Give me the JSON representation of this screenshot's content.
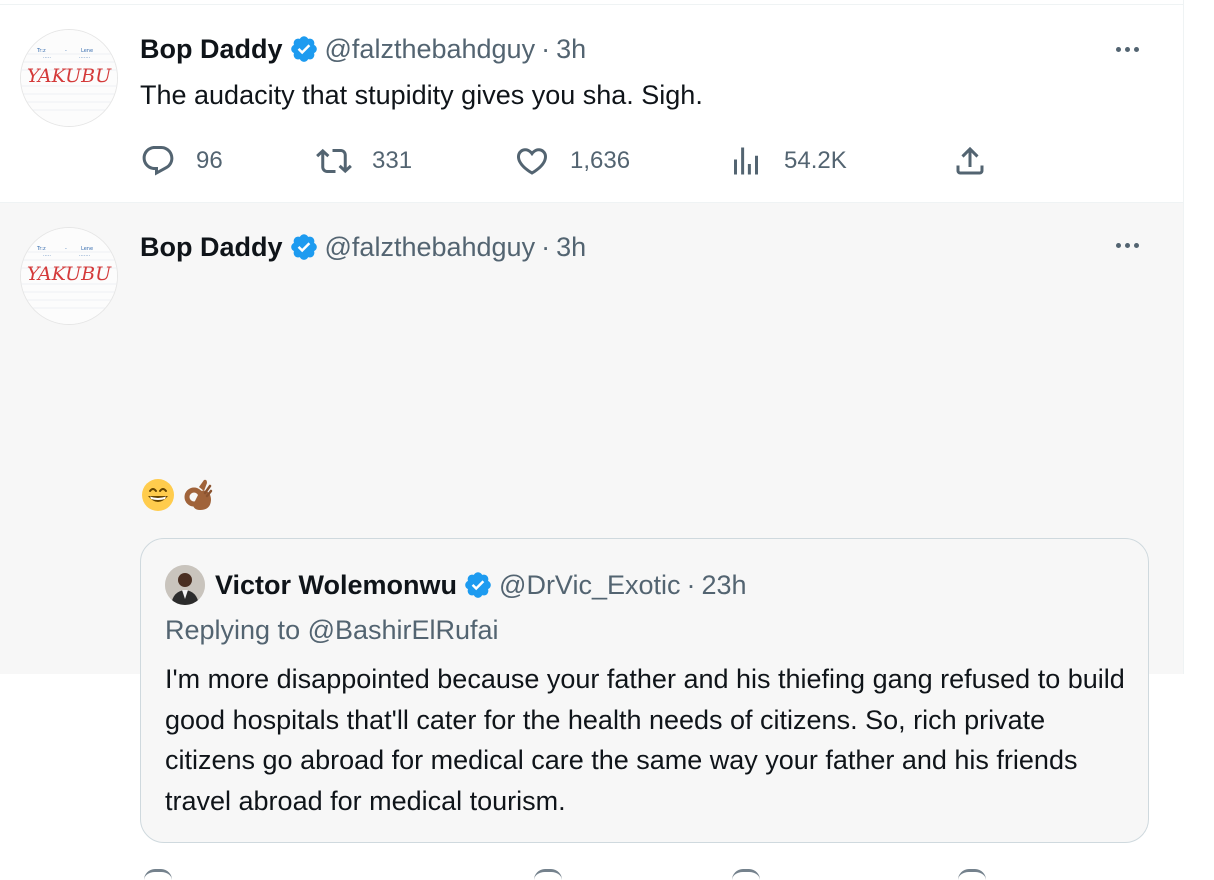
{
  "tweets": [
    {
      "author_name": "Bop Daddy",
      "handle": "@falzthebahdguy",
      "separator": "·",
      "time": "3h",
      "avatar_text": "YAKUBU",
      "text": "The audacity that stupidity gives you sha. Sigh.",
      "stats": {
        "replies": "96",
        "retweets": "331",
        "likes": "1,636",
        "views": "54.2K"
      }
    },
    {
      "author_name": "Bop Daddy",
      "handle": "@falzthebahdguy",
      "separator": "·",
      "time": "3h",
      "avatar_text": "YAKUBU",
      "emojis": [
        "grinning-face-with-smiling-eyes",
        "ok-hand-medium-dark-skin"
      ],
      "quote": {
        "author_name": "Victor Wolemonwu",
        "handle": "@DrVic_Exotic",
        "separator": "·",
        "time": "23h",
        "replying_to": "Replying to @BashirElRufai",
        "text": "I'm more disappointed because your father and his thiefing gang refused to build good hospitals that'll cater for the health needs of citizens. So, rich private citizens go abroad for medical care the same way your father and his friends travel abroad for medical tourism."
      }
    }
  ],
  "colors": {
    "text_primary": "#0f1419",
    "text_secondary": "#536471",
    "verified_blue": "#1d9bf0",
    "border": "#cfd9de",
    "highlight_bg": "#f7f7f7"
  },
  "icons": [
    "verified-badge-icon",
    "more-icon",
    "reply-icon",
    "retweet-icon",
    "like-icon",
    "views-icon",
    "share-icon"
  ]
}
